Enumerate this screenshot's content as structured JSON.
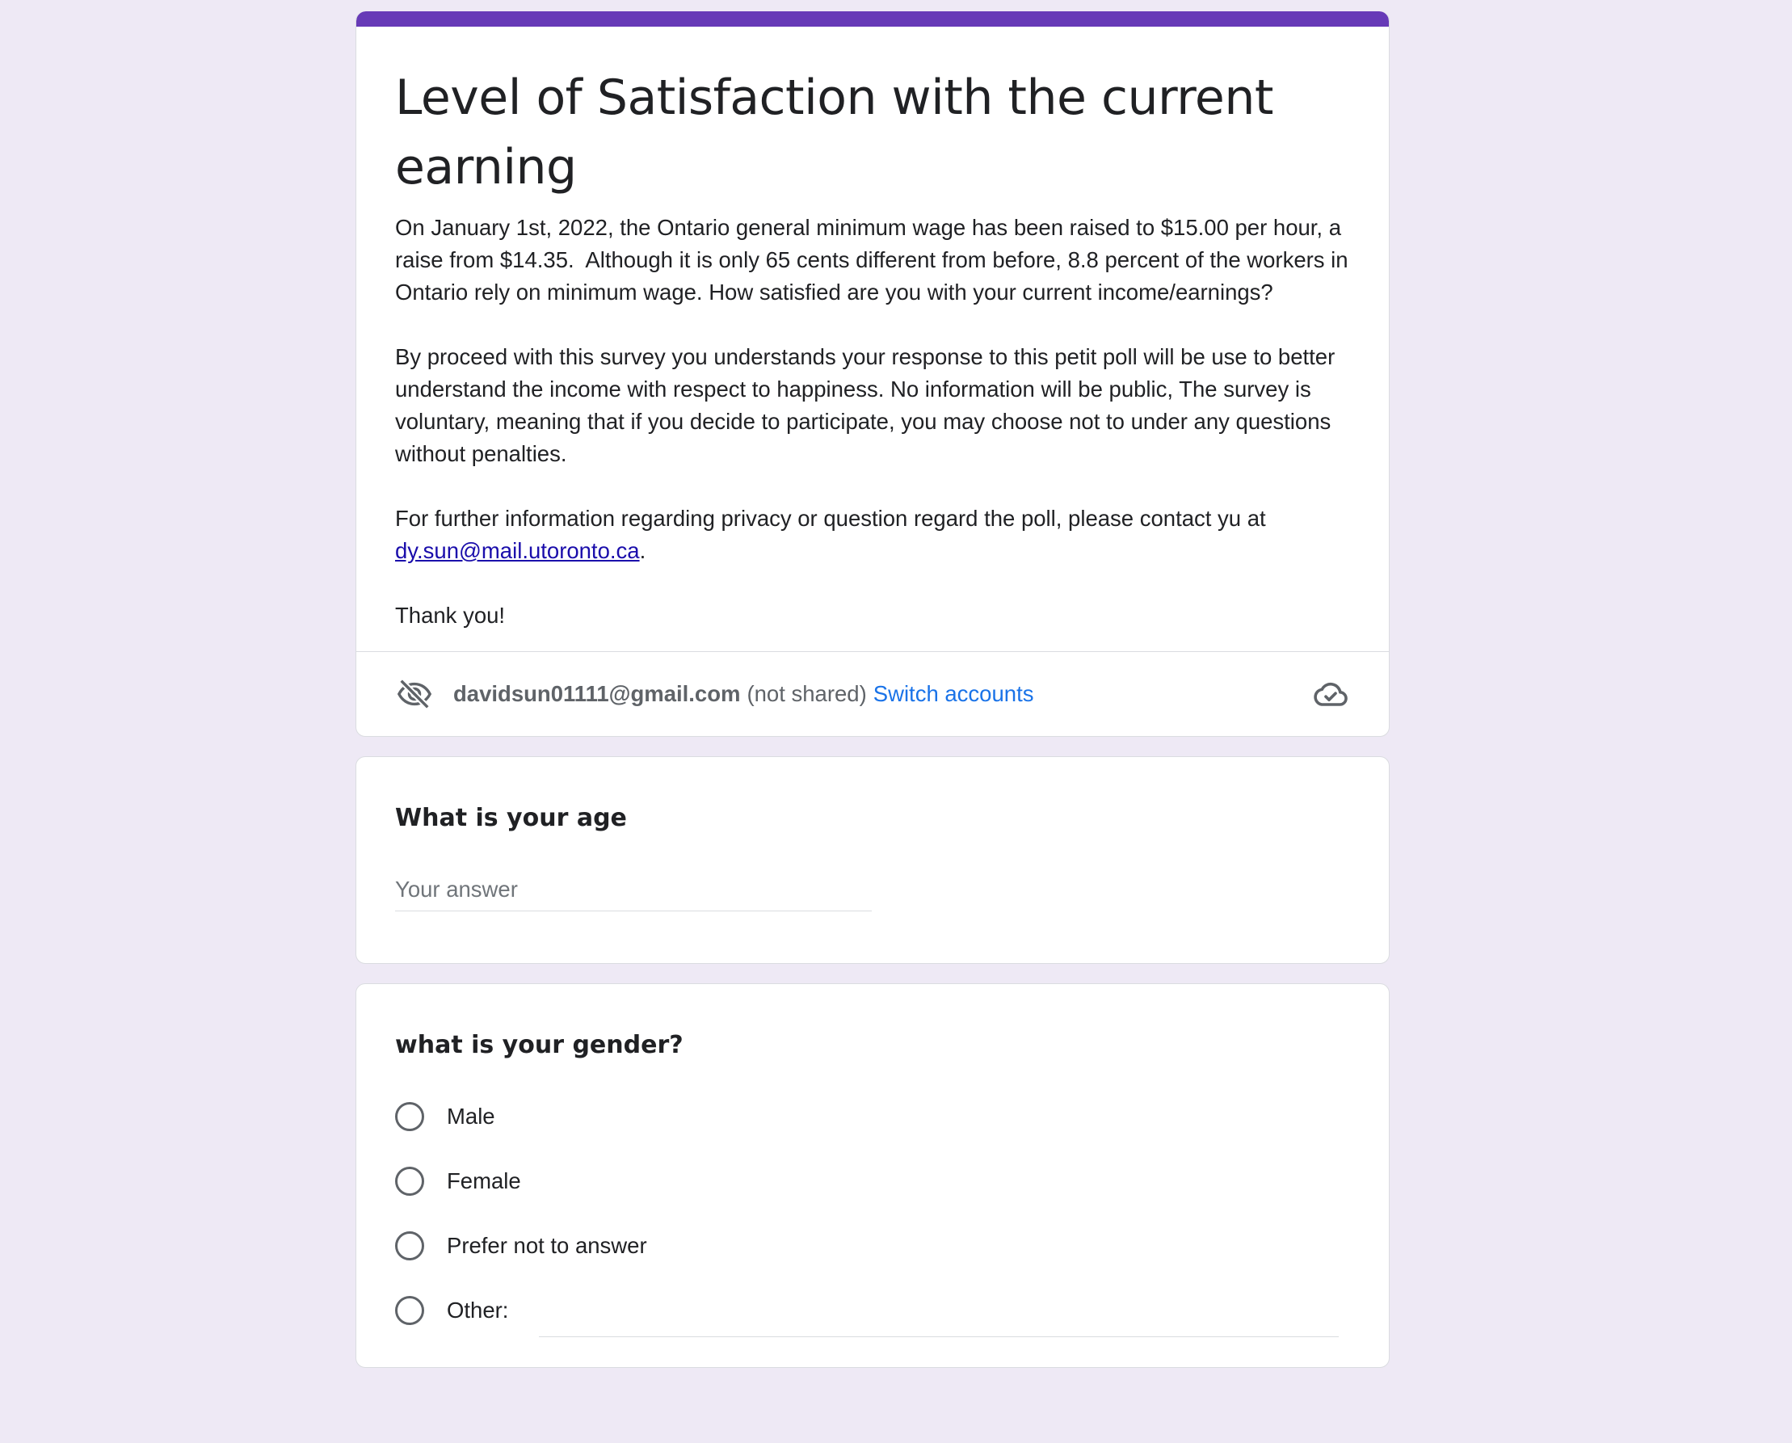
{
  "form": {
    "title": "Level of Satisfaction with the current earning",
    "description": {
      "p1": "On January 1st, 2022, the Ontario general minimum wage has been raised to $15.00 per hour, a raise from $14.35.  Although it is only 65 cents different from before, 8.8 percent of the workers in Ontario rely on minimum wage. How satisfied are you with your current income/earnings?",
      "p2": "By proceed with this survey you understands your response to this petit poll will be use to better understand the income with respect to happiness. No information will be public, The survey is voluntary, meaning that if you decide to participate, you may choose not to under any questions without penalties.",
      "p3_prefix": "For further information regarding privacy or question regard the poll, please contact yu at ",
      "p3_email": "dy.sun@mail.utoronto.ca",
      "p3_suffix": ".",
      "p4": "Thank you!"
    },
    "accent_color": "#673ab7"
  },
  "account": {
    "email": "davidsun01111@gmail.com",
    "not_shared": "(not shared)",
    "switch_label": "Switch accounts",
    "icons": {
      "privacy": "visibility-off-icon",
      "saved": "cloud-done-icon"
    }
  },
  "questions": {
    "age": {
      "title": "What is your age",
      "placeholder": "Your answer"
    },
    "gender": {
      "title": "what is your gender?",
      "options": [
        "Male",
        "Female",
        "Prefer not to answer",
        "Other:"
      ]
    }
  }
}
